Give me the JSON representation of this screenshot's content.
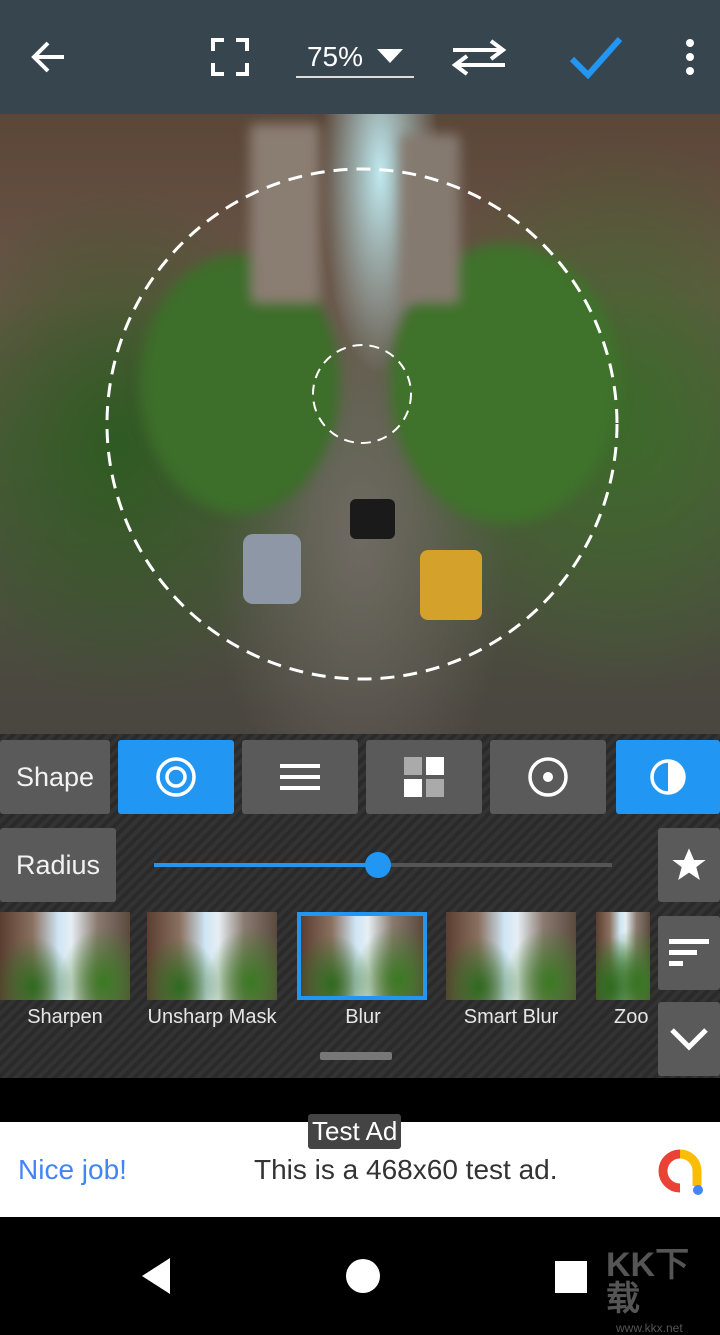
{
  "toolbar": {
    "zoom": "75%",
    "icons": [
      "arrow-left-icon",
      "fullscreen-icon",
      "dropdown-icon",
      "swap-icon",
      "check-icon",
      "more-vert-icon"
    ],
    "accent": "#2196f3"
  },
  "panel": {
    "shape_label": "Shape",
    "shapes": [
      {
        "icon": "concentric-circle-icon",
        "selected": true
      },
      {
        "icon": "linear-lines-icon",
        "selected": false
      },
      {
        "icon": "grid-squares-icon",
        "selected": false
      },
      {
        "icon": "dot-circle-icon",
        "selected": false
      },
      {
        "icon": "half-circle-icon",
        "selected": true
      }
    ],
    "radius_label": "Radius",
    "radius_value": 0.49,
    "filters": [
      "Sharpen",
      "Unsharp Mask",
      "Blur",
      "Smart Blur",
      "Zoo"
    ],
    "selected_filter": "Blur"
  },
  "ad": {
    "badge": "Test Ad",
    "headline": "Nice job!",
    "text": "This is a 468x60 test ad."
  },
  "watermark": "KK下载 www.kkx.net"
}
